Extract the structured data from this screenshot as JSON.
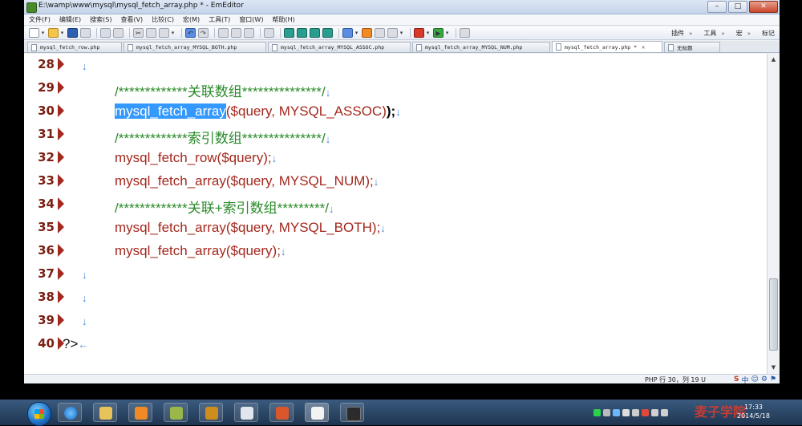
{
  "window": {
    "title": "E:\\wamp\\www\\mysql\\mysql_fetch_array.php * - EmEditor",
    "btn_min": "–",
    "btn_max": "□",
    "btn_close": "✕"
  },
  "menu": [
    "文件(F)",
    "编辑(E)",
    "搜索(S)",
    "查看(V)",
    "比较(C)",
    "宏(M)",
    "工具(T)",
    "窗口(W)",
    "帮助(H)"
  ],
  "toolbar": {
    "right_labels": [
      "插件",
      "工具",
      "宏",
      "标记"
    ],
    "chevron": "»"
  },
  "tabs": [
    {
      "label": "mysql_fetch_row.php",
      "active": false
    },
    {
      "label": "mysql_fetch_array_MYSQL_BOTH.php",
      "active": false
    },
    {
      "label": "mysql_fetch_array_MYSQL_ASSOC.php",
      "active": false
    },
    {
      "label": "mysql_fetch_array_MYSQL_NUM.php",
      "active": false
    },
    {
      "label": "mysql_fetch_array.php *",
      "active": true,
      "close": "✕"
    },
    {
      "label": "无标题",
      "active": false
    }
  ],
  "editor": {
    "newline_mark": "↓",
    "eof_mark": "←",
    "lines": [
      {
        "num": "28",
        "text": ""
      },
      {
        "num": "29",
        "comment_a": "/*************",
        "comment_cn": "关联数组",
        "comment_b": "***************/"
      },
      {
        "num": "30",
        "sel": "mysql_fetch_array",
        "rest": "($query, MYSQL_ASSOC)",
        "end": ");"
      },
      {
        "num": "31",
        "comment_a": "/*************",
        "comment_cn": "索引数组",
        "comment_b": "***************/"
      },
      {
        "num": "32",
        "code": "mysql_fetch_row($query);"
      },
      {
        "num": "33",
        "code": "mysql_fetch_array($query, MYSQL_NUM);"
      },
      {
        "num": "34",
        "comment_a": "/*************",
        "comment_cn": "关联+索引数组",
        "comment_b": "*********/"
      },
      {
        "num": "35",
        "code": "mysql_fetch_array($query, MYSQL_BOTH);"
      },
      {
        "num": "36",
        "code": "mysql_fetch_array($query);"
      },
      {
        "num": "37",
        "text": ""
      },
      {
        "num": "38",
        "text": ""
      },
      {
        "num": "39",
        "text": ""
      },
      {
        "num": "40",
        "close_tag": "?>"
      }
    ]
  },
  "status": {
    "text": "PHP  行 30，列 19  U",
    "ime": [
      "中",
      "☺",
      "⚙",
      "⚑"
    ]
  },
  "taskbar": {
    "clock_time": "17:33",
    "clock_date": "2014/5/18",
    "watermark": "麦子学院"
  }
}
